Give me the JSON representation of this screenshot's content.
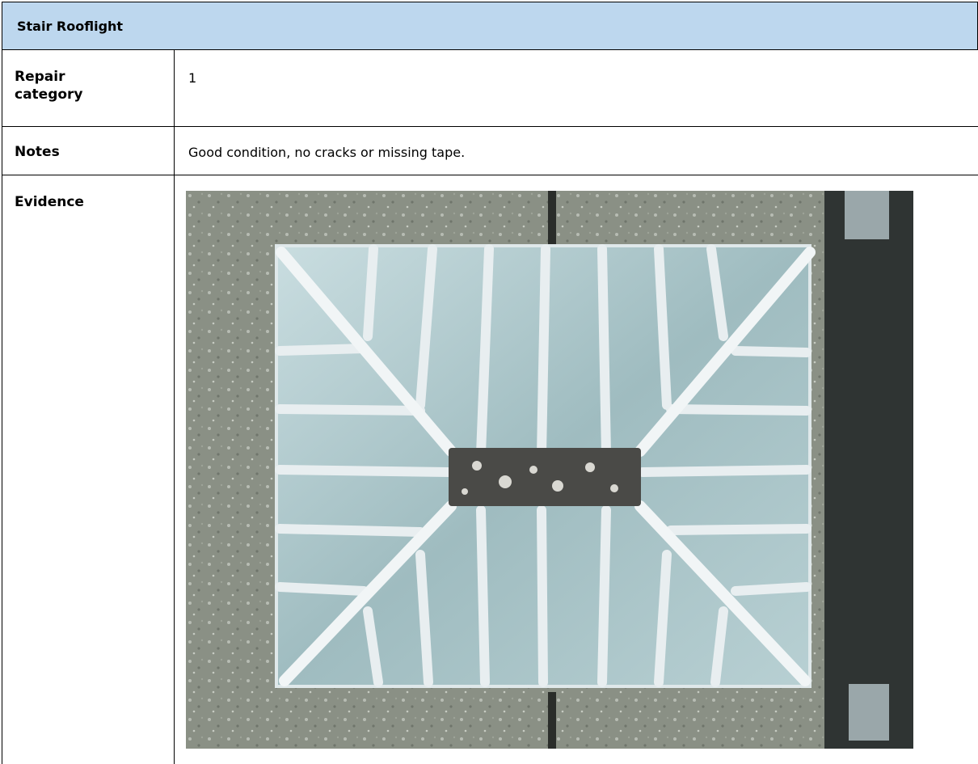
{
  "table": {
    "title": "Stair Rooflight",
    "rows": {
      "repair": {
        "label": "Repair category",
        "value": "1"
      },
      "notes": {
        "label": "Notes",
        "value": "Good condition, no cracks or missing tape."
      },
      "evidence": {
        "label": "Evidence"
      }
    }
  },
  "colors": {
    "header_bg": "#bdd7ee",
    "border": "#000000"
  }
}
